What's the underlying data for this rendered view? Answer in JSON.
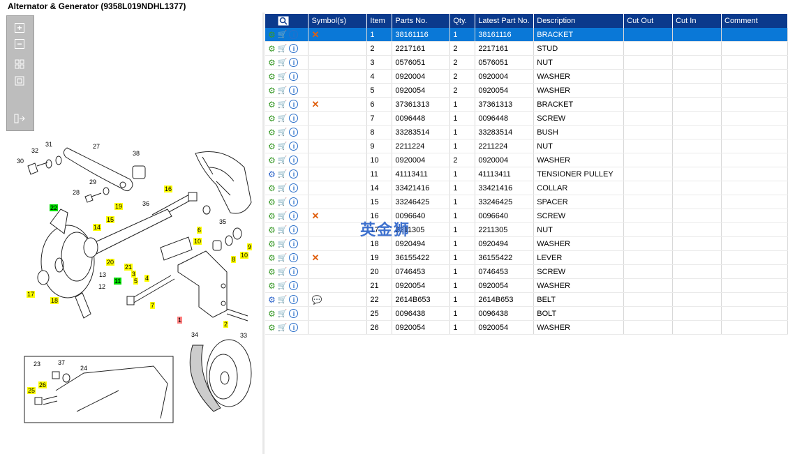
{
  "title": "Alternator & Generator (9358L019NDHL1377)",
  "toolbar": {
    "zoom_in": "+",
    "zoom_out": "−"
  },
  "columns": [
    "",
    "Symbol(s)",
    "Item",
    "Parts No.",
    "Qty.",
    "Latest Part No.",
    "Description",
    "Cut Out",
    "Cut In",
    "Comment"
  ],
  "rows": [
    {
      "gear": "green",
      "symbol": "x",
      "item": "1",
      "part": "38161116",
      "qty": "1",
      "latest": "38161116",
      "desc": "BRACKET",
      "selected": true
    },
    {
      "gear": "green",
      "symbol": "",
      "item": "2",
      "part": "2217161",
      "qty": "2",
      "latest": "2217161",
      "desc": "STUD"
    },
    {
      "gear": "green",
      "symbol": "",
      "item": "3",
      "part": "0576051",
      "qty": "2",
      "latest": "0576051",
      "desc": "NUT"
    },
    {
      "gear": "green",
      "symbol": "",
      "item": "4",
      "part": "0920004",
      "qty": "2",
      "latest": "0920004",
      "desc": "WASHER"
    },
    {
      "gear": "green",
      "symbol": "",
      "item": "5",
      "part": "0920054",
      "qty": "2",
      "latest": "0920054",
      "desc": "WASHER"
    },
    {
      "gear": "green",
      "symbol": "x",
      "item": "6",
      "part": "37361313",
      "qty": "1",
      "latest": "37361313",
      "desc": "BRACKET"
    },
    {
      "gear": "green",
      "symbol": "",
      "item": "7",
      "part": "0096448",
      "qty": "1",
      "latest": "0096448",
      "desc": "SCREW"
    },
    {
      "gear": "green",
      "symbol": "",
      "item": "8",
      "part": "33283514",
      "qty": "1",
      "latest": "33283514",
      "desc": "BUSH"
    },
    {
      "gear": "green",
      "symbol": "",
      "item": "9",
      "part": "2211224",
      "qty": "1",
      "latest": "2211224",
      "desc": "NUT"
    },
    {
      "gear": "green",
      "symbol": "",
      "item": "10",
      "part": "0920004",
      "qty": "2",
      "latest": "0920004",
      "desc": "WASHER"
    },
    {
      "gear": "blue",
      "symbol": "",
      "item": "11",
      "part": "41113411",
      "qty": "1",
      "latest": "41113411",
      "desc": "TENSIONER PULLEY"
    },
    {
      "gear": "green",
      "symbol": "",
      "item": "14",
      "part": "33421416",
      "qty": "1",
      "latest": "33421416",
      "desc": "COLLAR"
    },
    {
      "gear": "green",
      "symbol": "",
      "item": "15",
      "part": "33246425",
      "qty": "1",
      "latest": "33246425",
      "desc": "SPACER"
    },
    {
      "gear": "green",
      "symbol": "x",
      "item": "16",
      "part": "0096640",
      "qty": "1",
      "latest": "0096640",
      "desc": "SCREW"
    },
    {
      "gear": "green",
      "symbol": "",
      "item": "17",
      "part": "2211305",
      "qty": "1",
      "latest": "2211305",
      "desc": "NUT"
    },
    {
      "gear": "green",
      "symbol": "",
      "item": "18",
      "part": "0920494",
      "qty": "1",
      "latest": "0920494",
      "desc": "WASHER"
    },
    {
      "gear": "green",
      "symbol": "x",
      "item": "19",
      "part": "36155422",
      "qty": "1",
      "latest": "36155422",
      "desc": "LEVER"
    },
    {
      "gear": "green",
      "symbol": "",
      "item": "20",
      "part": "0746453",
      "qty": "1",
      "latest": "0746453",
      "desc": "SCREW"
    },
    {
      "gear": "green",
      "symbol": "",
      "item": "21",
      "part": "0920054",
      "qty": "1",
      "latest": "0920054",
      "desc": "WASHER"
    },
    {
      "gear": "blue",
      "symbol": "note",
      "item": "22",
      "part": "2614B653",
      "qty": "1",
      "latest": "2614B653",
      "desc": "BELT"
    },
    {
      "gear": "green",
      "symbol": "",
      "item": "25",
      "part": "0096438",
      "qty": "1",
      "latest": "0096438",
      "desc": "BOLT"
    },
    {
      "gear": "green",
      "symbol": "",
      "item": "26",
      "part": "0920054",
      "qty": "1",
      "latest": "0920054",
      "desc": "WASHER"
    }
  ],
  "watermark": "英金狮",
  "callouts": [
    {
      "t": "30",
      "c": ""
    },
    {
      "t": "32",
      "c": ""
    },
    {
      "t": "31",
      "c": ""
    },
    {
      "t": "27",
      "c": ""
    },
    {
      "t": "38",
      "c": ""
    },
    {
      "t": "29",
      "c": ""
    },
    {
      "t": "28",
      "c": ""
    },
    {
      "t": "16",
      "c": "y"
    },
    {
      "t": "22",
      "c": "g"
    },
    {
      "t": "19",
      "c": "y"
    },
    {
      "t": "36",
      "c": ""
    },
    {
      "t": "15",
      "c": "y"
    },
    {
      "t": "14",
      "c": "y"
    },
    {
      "t": "35",
      "c": ""
    },
    {
      "t": "6",
      "c": "y"
    },
    {
      "t": "10",
      "c": "y"
    },
    {
      "t": "9",
      "c": "y"
    },
    {
      "t": "8",
      "c": "y"
    },
    {
      "t": "10",
      "c": "y"
    },
    {
      "t": "20",
      "c": "y"
    },
    {
      "t": "21",
      "c": "y"
    },
    {
      "t": "3",
      "c": "y"
    },
    {
      "t": "13",
      "c": ""
    },
    {
      "t": "5",
      "c": "y"
    },
    {
      "t": "4",
      "c": "y"
    },
    {
      "t": "11",
      "c": "g"
    },
    {
      "t": "12",
      "c": ""
    },
    {
      "t": "17",
      "c": "y"
    },
    {
      "t": "18",
      "c": "y"
    },
    {
      "t": "7",
      "c": "y"
    },
    {
      "t": "1",
      "c": "r"
    },
    {
      "t": "2",
      "c": "y"
    },
    {
      "t": "34",
      "c": ""
    },
    {
      "t": "33",
      "c": ""
    },
    {
      "t": "23",
      "c": ""
    },
    {
      "t": "37",
      "c": ""
    },
    {
      "t": "24",
      "c": ""
    },
    {
      "t": "26",
      "c": "y"
    },
    {
      "t": "25",
      "c": "y"
    }
  ]
}
